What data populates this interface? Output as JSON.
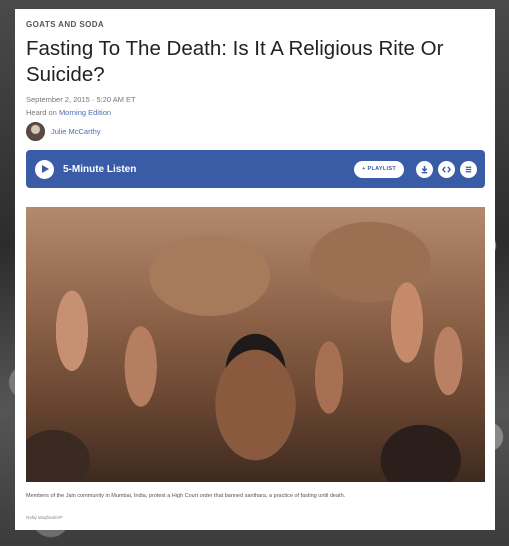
{
  "article": {
    "section": "GOATS AND SODA",
    "headline": "Fasting To The Death: Is It A Religious Rite Or Suicide?",
    "date": "September 2, 2015 · 5:20 AM ET",
    "heard_prefix": "Heard on ",
    "heard_show": "Morning Edition",
    "author": "Julie McCarthy"
  },
  "player": {
    "listen_label": "5-Minute Listen",
    "playlist_label": "+ PLAYLIST",
    "accent_color": "#3a5ba5",
    "icons": [
      "play-icon",
      "download-icon",
      "embed-icon",
      "transcript-icon"
    ]
  },
  "photo": {
    "caption": "Members of the Jain community in Mumbai, India, protest a High Court order that banned santhara, a practice of fasting until death.",
    "credit": "Rafiq Maqbool/AP"
  }
}
